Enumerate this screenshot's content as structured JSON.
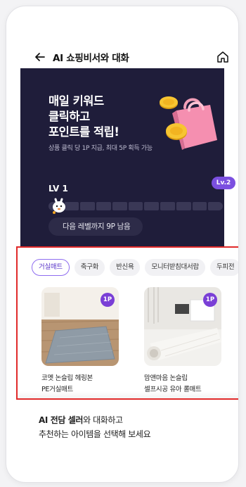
{
  "header": {
    "title": "AI 쇼핑비서와 대화",
    "back_icon": "arrow-left-icon",
    "home_icon": "home-icon"
  },
  "banner": {
    "headline_line1": "매일 키워드",
    "headline_line2": "클릭하고",
    "headline_line3": "포인트를 적립!",
    "subtext": "상품 클릭 당 1P 지급, 최대 5P 획득 가능",
    "current_level": "LV 1",
    "next_level": "Lv.2",
    "remaining": "다음 레벨까지 9P 남음",
    "level_progress": 0.08,
    "background_color": "#1f1d3a"
  },
  "categories": [
    {
      "label": "거실매트",
      "active": true
    },
    {
      "label": "축구화",
      "active": false
    },
    {
      "label": "반신욕",
      "active": false
    },
    {
      "label": "모니터받침대서랍",
      "active": false
    },
    {
      "label": "두피전",
      "active": false
    }
  ],
  "products": [
    {
      "badge": "1P",
      "name_line1": "코멧 논슬립 헤링본",
      "name_line2": "PE거실매트"
    },
    {
      "badge": "1P",
      "name_line1": "맘앤마음 논슬립",
      "name_line2": "셀프시공 유아 롤매트"
    }
  ],
  "footer": {
    "bold": "AI 전담 셀러",
    "line1_rest": "와 대화하고",
    "line2": "추천하는 아이템을 선택해 보세요"
  },
  "colors": {
    "accent": "#7b4fe0",
    "highlight_border": "#e12a2a"
  }
}
